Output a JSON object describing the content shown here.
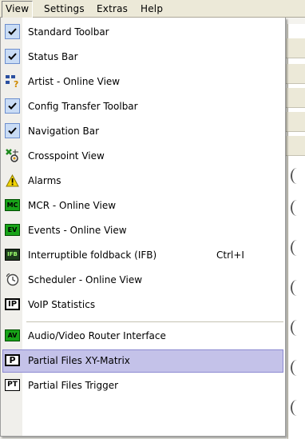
{
  "menubar": {
    "items": [
      {
        "label": "View",
        "active": true
      },
      {
        "label": "Settings",
        "active": false
      },
      {
        "label": "Extras",
        "active": false
      },
      {
        "label": "Help",
        "active": false
      }
    ]
  },
  "menu": {
    "items": [
      {
        "label": "Standard Toolbar",
        "icon": "check-icon",
        "checked": true
      },
      {
        "label": "Status Bar",
        "icon": "check-icon",
        "checked": true
      },
      {
        "label": "Artist - Online View",
        "icon": "artist-icon"
      },
      {
        "label": "Config Transfer Toolbar",
        "icon": "check-icon",
        "checked": true
      },
      {
        "label": "Navigation Bar",
        "icon": "check-icon",
        "checked": true
      },
      {
        "label": "Crosspoint View",
        "icon": "crosspoint-icon"
      },
      {
        "label": "Alarms",
        "icon": "warning-icon"
      },
      {
        "label": "MCR - Online View",
        "icon": "mcr-icon",
        "icon_text": "MC"
      },
      {
        "label": "Events - Online View",
        "icon": "events-icon",
        "icon_text": "EV"
      },
      {
        "label": "Interruptible foldback (IFB)",
        "icon": "ifb-icon",
        "icon_text": "IFB",
        "shortcut": "Ctrl+I"
      },
      {
        "label": "Scheduler - Online View",
        "icon": "scheduler-icon"
      },
      {
        "label": "VoIP Statistics",
        "icon": "voip-icon",
        "icon_text": "IP"
      },
      {
        "label": "Audio/Video Router Interface",
        "icon": "av-router-icon",
        "icon_text": "AV"
      },
      {
        "label": "Partial Files XY-Matrix",
        "icon": "partial-files-icon",
        "icon_text": "P",
        "highlighted": true
      },
      {
        "label": "Partial Files Trigger",
        "icon": "partial-files-trigger-icon",
        "icon_text": "PT"
      }
    ]
  },
  "colors": {
    "highlight": "#c4c2e9",
    "check_bg": "#c9dcf5",
    "tag_green": "#18a318"
  }
}
